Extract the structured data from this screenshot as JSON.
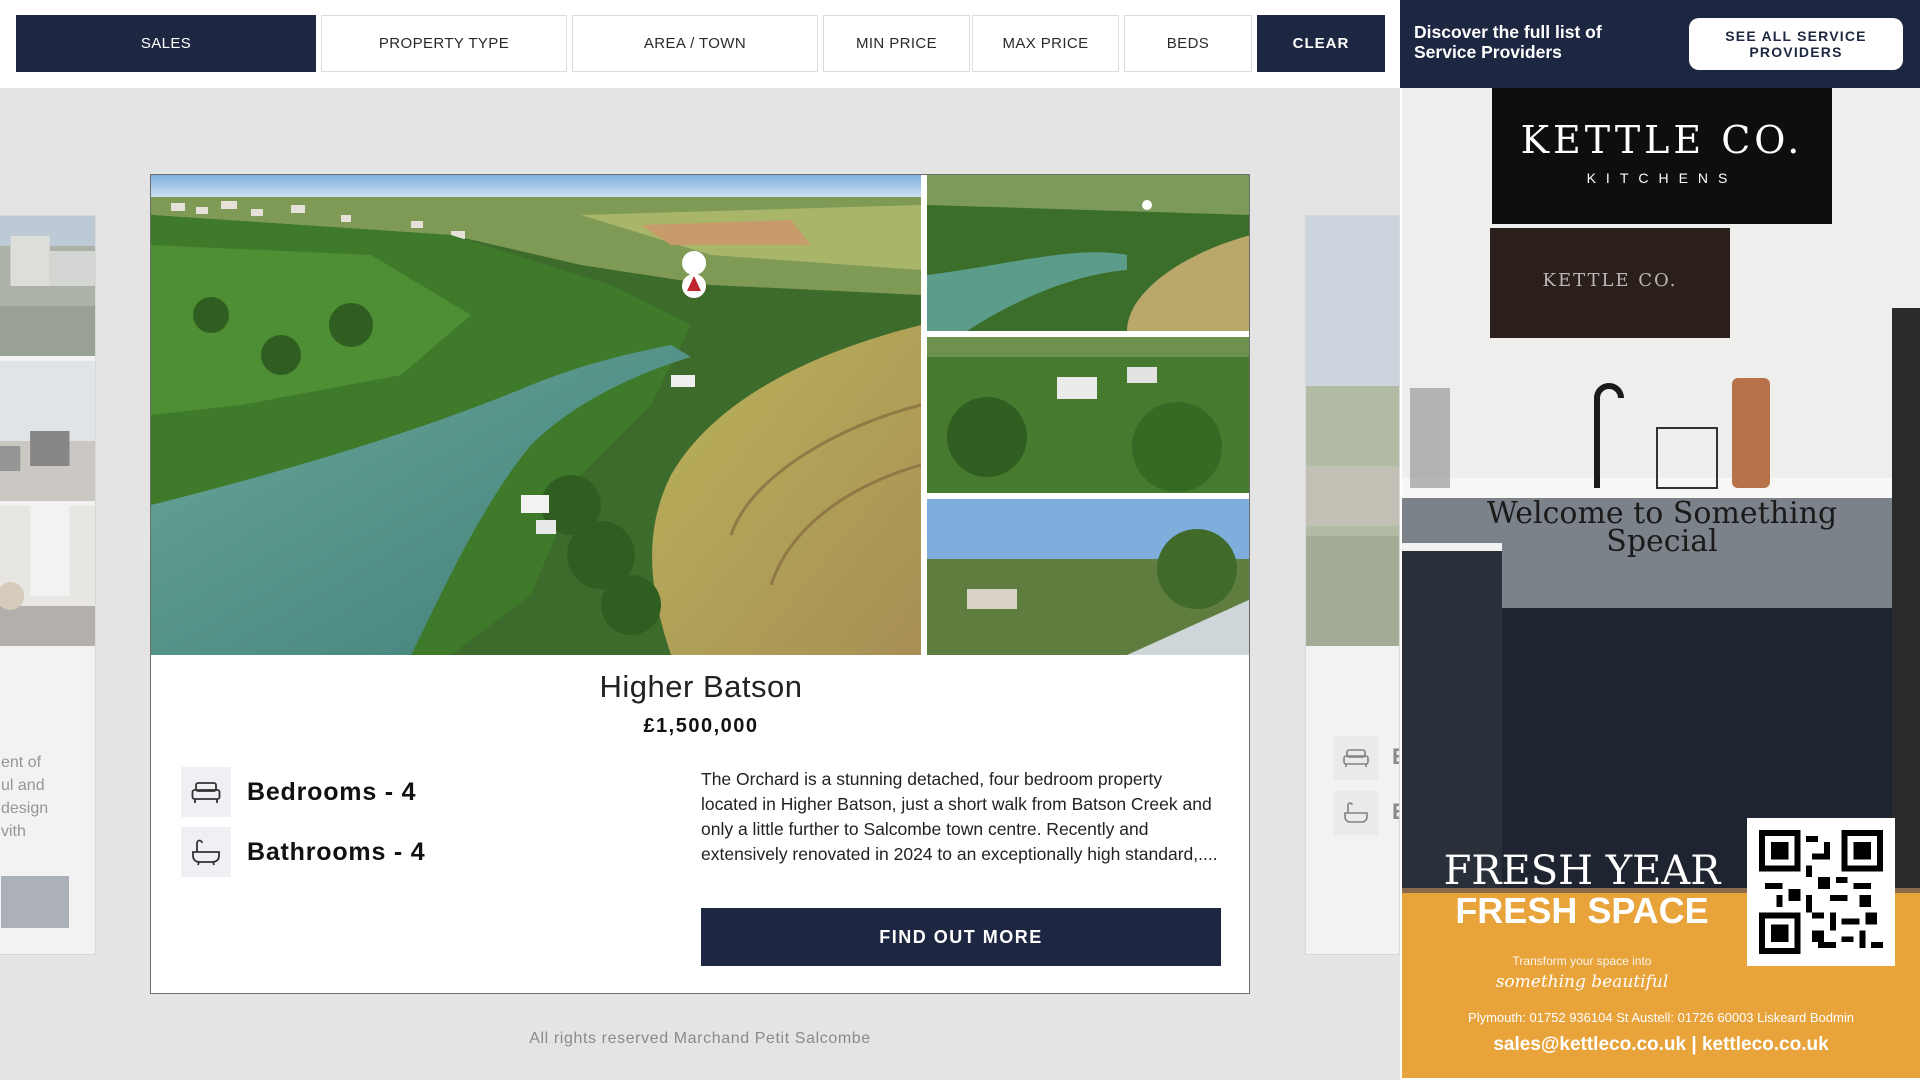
{
  "filters": {
    "sales": "SALES",
    "property_type": "PROPERTY TYPE",
    "area_town": "AREA / TOWN",
    "min_price": "MIN PRICE",
    "max_price": "MAX PRICE",
    "beds": "BEDS",
    "clear": "CLEAR"
  },
  "side_left": {
    "text_lines": "ent of\nul and\ndesign\nvith"
  },
  "side_right": {
    "letter1": "E",
    "letter2": "E"
  },
  "property": {
    "title": "Higher Batson",
    "price": "£1,500,000",
    "bedrooms": "Bedrooms - 4",
    "bathrooms": "Bathrooms - 4",
    "description": "The Orchard is a stunning detached, four bedroom property located in Higher Batson, just a short walk from Batson Creek and only a little further to Salcombe town centre. Recently and extensively renovated in 2024 to an exceptionally high standard,....",
    "cta": "FIND OUT MORE"
  },
  "footer": "All rights reserved Marchand Petit Salcombe",
  "panel": {
    "discover": "Discover the full list of Service Providers",
    "see_all": "SEE ALL SERVICE PROVIDERS"
  },
  "ad": {
    "brand": "KETTLE CO.",
    "brand_sub": "KITCHENS",
    "tv_text": "KETTLE CO.",
    "welcome": "Welcome to Something Special",
    "fresh1": "FRESH YEAR",
    "fresh2": "FRESH SPACE",
    "transform": "Transform your space into",
    "beautiful": "something beautiful",
    "phones": "Plymouth: 01752 936104   St Austell: 01726 60003   Liskeard   Bodmin",
    "contact": "sales@kettleco.co.uk | kettleco.co.uk"
  },
  "colors": {
    "navy": "#1e2741",
    "page_bg": "#e4e4e4",
    "ad_orange": "#e8a33b"
  }
}
